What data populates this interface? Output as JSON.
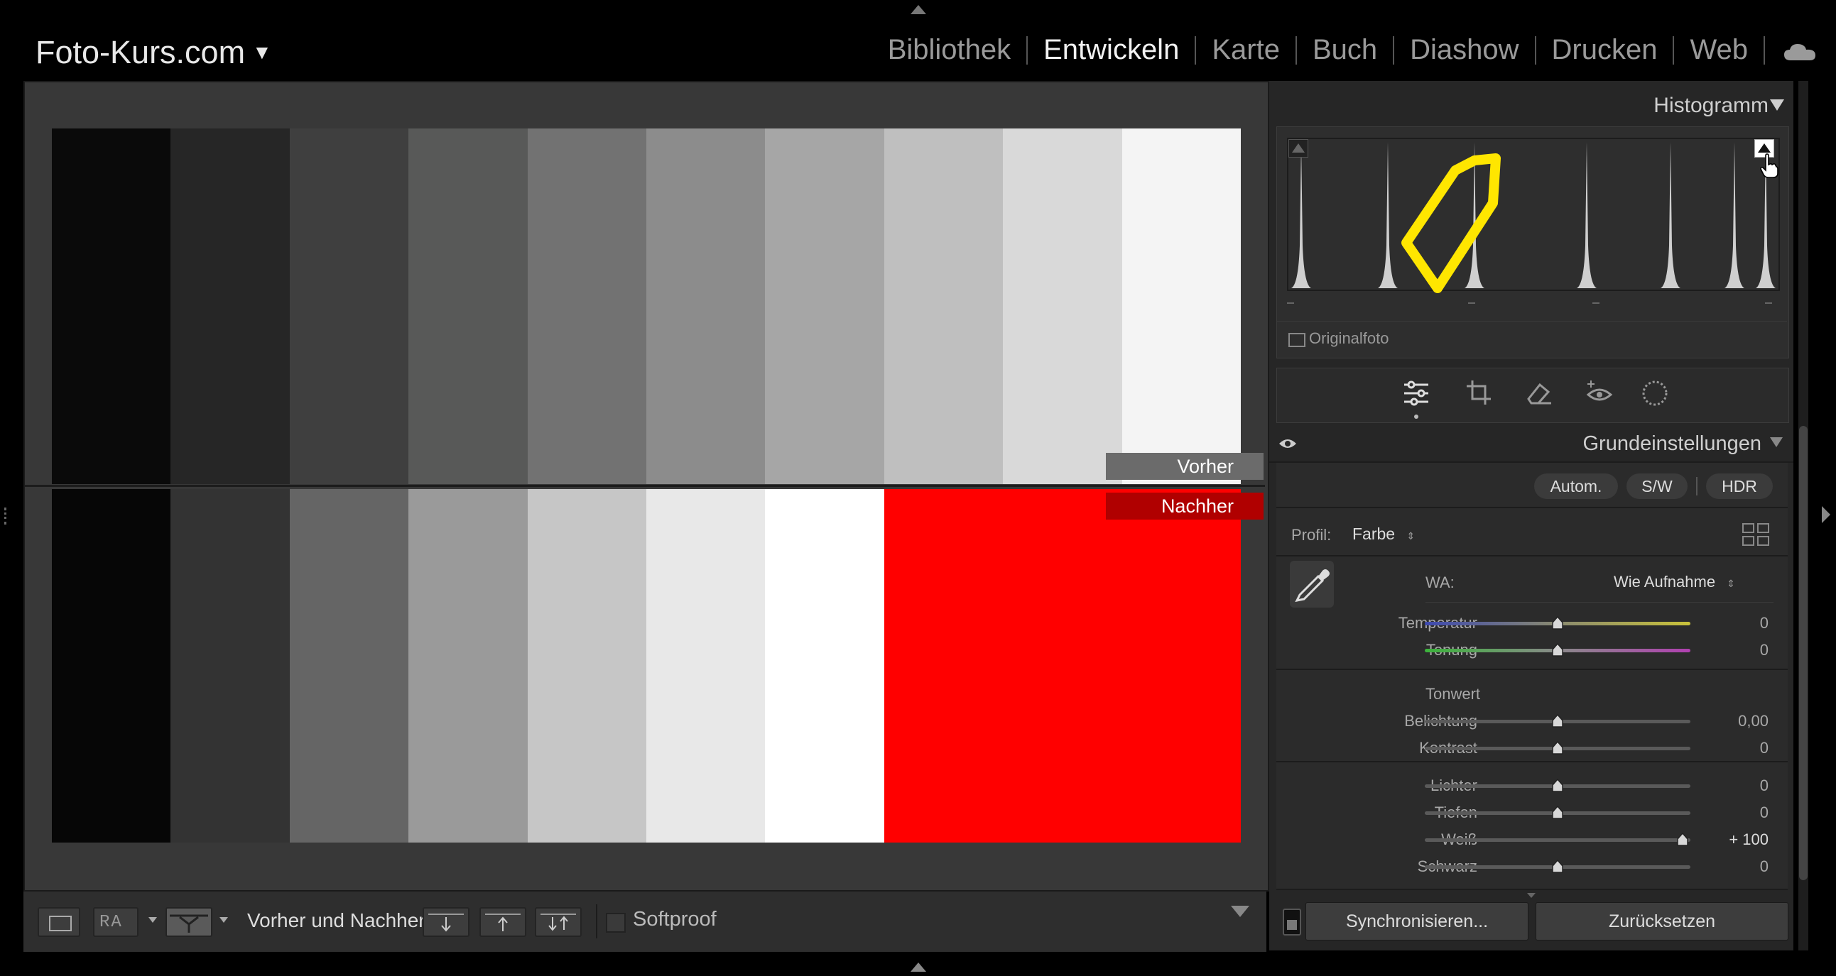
{
  "topbar": {
    "identity": "Foto-Kurs.com",
    "modules": [
      {
        "label": "Bibliothek",
        "active": false
      },
      {
        "label": "Entwickeln",
        "active": true
      },
      {
        "label": "Karte",
        "active": false
      },
      {
        "label": "Buch",
        "active": false
      },
      {
        "label": "Diashow",
        "active": false
      },
      {
        "label": "Drucken",
        "active": false
      },
      {
        "label": "Web",
        "active": false
      }
    ],
    "cloud_icon": "cloud-icon"
  },
  "viewer": {
    "before_label": "Vorher",
    "after_label": "Nachher",
    "before_tones": [
      "#0a0a0a",
      "#262626",
      "#3f3f3f",
      "#585958",
      "#727272",
      "#8c8c8c",
      "#a6a6a6",
      "#bfbfbf",
      "#d9d9d9",
      "#f4f4f4"
    ],
    "after_tones": [
      "#060606",
      "#333333",
      "#656565",
      "#9a9a9a",
      "#c6c6c6",
      "#e8e8e8",
      "#ffffff",
      "#ff0000",
      "#ff0000",
      "#ff0000"
    ],
    "clipping_color": "#ff0000"
  },
  "toolbar": {
    "before_after_label": "Vorher und Nachher:",
    "softproof_label": "Softproof"
  },
  "histogram": {
    "title": "Histogramm",
    "original_photo_label": "Originalfoto",
    "annotation_color": "#ffe600"
  },
  "basic": {
    "title": "Grundeinstellungen",
    "auto_label": "Autom.",
    "bw_label": "S/W",
    "hdr_label": "HDR",
    "profile_label": "Profil:",
    "profile_value": "Farbe",
    "wb_label": "WA:",
    "wb_value": "Wie Aufnahme",
    "tone_header": "Tonwert",
    "sliders": [
      {
        "key": "temp",
        "label": "Temperatur",
        "value": "0",
        "pos": 0.5
      },
      {
        "key": "tint",
        "label": "Tonung",
        "value": "0",
        "pos": 0.5
      },
      {
        "key": "exposure",
        "label": "Belichtung",
        "value": "0,00",
        "pos": 0.5
      },
      {
        "key": "contrast",
        "label": "Kontrast",
        "value": "0",
        "pos": 0.5
      },
      {
        "key": "highlights",
        "label": "Lichter",
        "value": "0",
        "pos": 0.5
      },
      {
        "key": "shadows",
        "label": "Tiefen",
        "value": "0",
        "pos": 0.5
      },
      {
        "key": "whites",
        "label": "Weiß",
        "value": "+ 100",
        "pos": 0.97
      },
      {
        "key": "blacks",
        "label": "Schwarz",
        "value": "0",
        "pos": 0.5
      }
    ]
  },
  "footer": {
    "sync_label": "Synchronisieren...",
    "reset_label": "Zurücksetzen"
  }
}
